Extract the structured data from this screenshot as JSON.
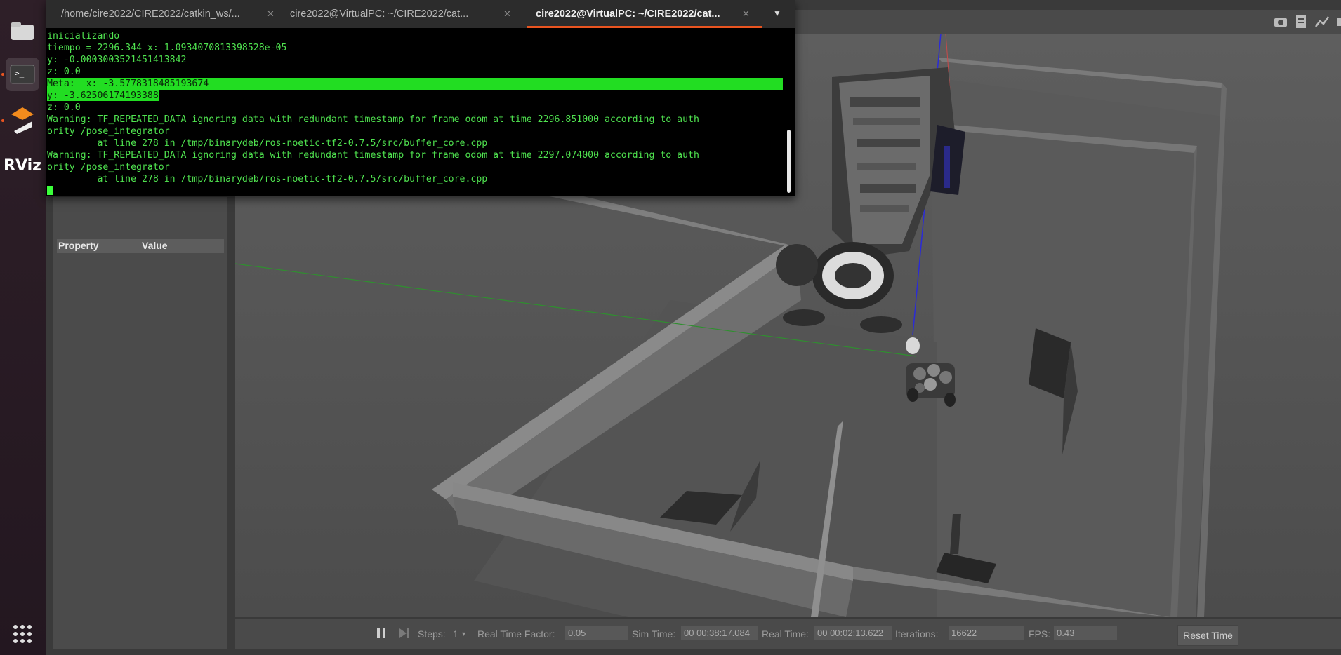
{
  "dock": {
    "items": [
      {
        "name": "files-icon"
      },
      {
        "name": "terminal-icon"
      },
      {
        "name": "gazebo-icon"
      },
      {
        "name": "rviz-icon",
        "label": "RViz"
      }
    ],
    "apps_grid": "show-applications-icon"
  },
  "terminal": {
    "tabs": [
      {
        "label": "/home/cire2022/CIRE2022/catkin_ws/..."
      },
      {
        "label": "cire2022@VirtualPC: ~/CIRE2022/cat..."
      },
      {
        "label": "cire2022@VirtualPC: ~/CIRE2022/cat..."
      }
    ],
    "lines": [
      "inicializando",
      "tiempo = 2296.344 x: 1.0934070813398528e-05",
      "y: -0.0003003521451413842",
      "z: 0.0",
      "Meta:  x: -3.5778318485193674",
      "y: -3.62506174193388",
      "z: 0.0",
      "Warning: TF_REPEATED_DATA ignoring data with redundant timestamp for frame odom at time 2296.851000 according to auth",
      "ority /pose_integrator",
      "         at line 278 in /tmp/binarydeb/ros-noetic-tf2-0.7.5/src/buffer_core.cpp",
      "Warning: TF_REPEATED_DATA ignoring data with redundant timestamp for frame odom at time 2297.074000 according to auth",
      "ority /pose_integrator",
      "         at line 278 in /tmp/binarydeb/ros-noetic-tf2-0.7.5/src/buffer_core.cpp"
    ]
  },
  "panel": {
    "property_header": "Property",
    "value_header": "Value"
  },
  "bottom_bar": {
    "steps_label": "Steps:",
    "steps_value": "1",
    "rtf_label": "Real Time Factor:",
    "rtf_value": "0.05",
    "sim_label": "Sim Time:",
    "sim_value": "00 00:38:17.084",
    "real_label": "Real Time:",
    "real_value": "00 00:02:13.622",
    "iter_label": "Iterations:",
    "iter_value": "16622",
    "fps_label": "FPS:",
    "fps_value": "0.43",
    "reset_label": "Reset Time"
  }
}
